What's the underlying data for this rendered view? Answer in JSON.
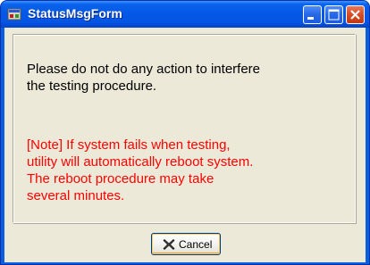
{
  "window": {
    "title": "StatusMsgForm"
  },
  "titlebar_buttons": {
    "minimize": "minimize-icon",
    "maximize": "maximize-icon",
    "close": "close-icon"
  },
  "message": {
    "main_text": "Please do not do any action to interfere\nthe testing procedure.",
    "note_text": "[Note] If system fails when testing,\nutility will automatically reboot system.\nThe reboot procedure may take\nseveral minutes."
  },
  "buttons": {
    "cancel_label": "Cancel",
    "cancel_icon": "red-x-icon"
  },
  "colors": {
    "titlebar": "#0458e6",
    "client_background": "#ece9d8",
    "note_text": "#ff0000",
    "close_button": "#d6481f"
  }
}
